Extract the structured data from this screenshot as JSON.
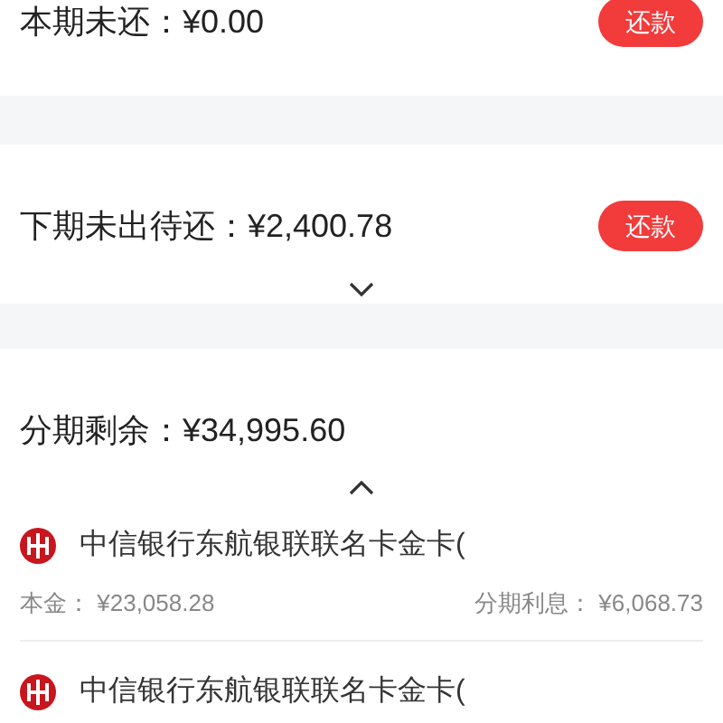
{
  "sections": [
    {
      "label": "本期未还：",
      "amount": "¥0.00",
      "button": "还款"
    },
    {
      "label": "下期未出待还：",
      "amount": "¥2,400.78",
      "button": "还款",
      "expanded": false
    },
    {
      "label": "分期剩余：",
      "amount": "¥34,995.60",
      "expanded": true,
      "items": [
        {
          "bank": "中信银行东航银联联名卡金卡(",
          "principal_label": "本金：",
          "principal": "¥23,058.28",
          "interest_label": "分期利息：",
          "interest": "¥6,068.73"
        },
        {
          "bank": "中信银行东航银联联名卡金卡("
        }
      ]
    }
  ]
}
